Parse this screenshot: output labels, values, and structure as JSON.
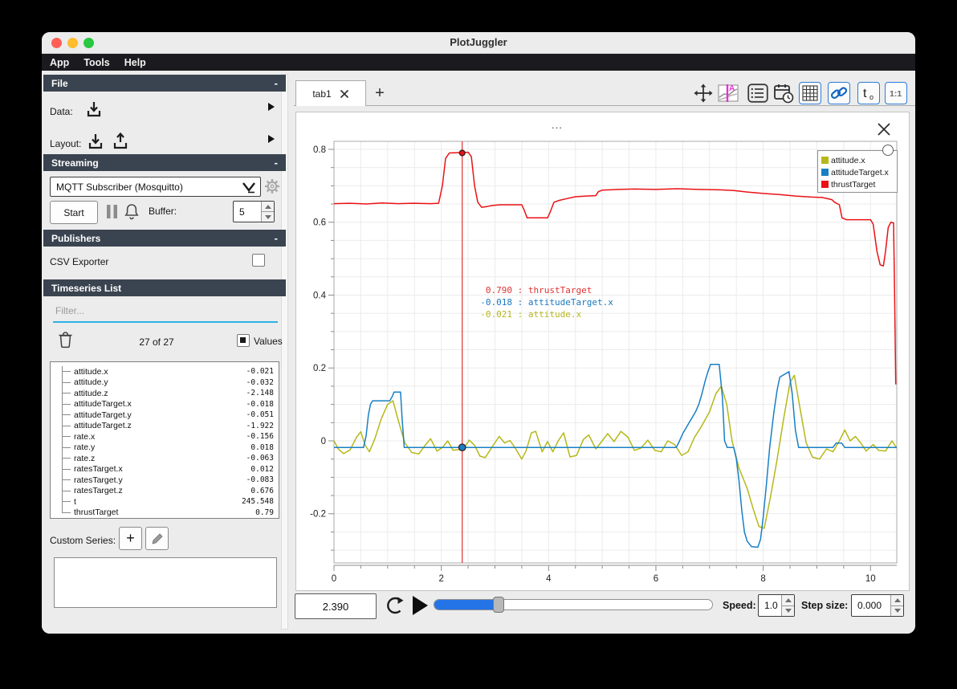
{
  "window": {
    "title": "PlotJuggler"
  },
  "menu": {
    "items": [
      "App",
      "Tools",
      "Help"
    ]
  },
  "icons": {
    "collapse": "-",
    "tracker_letter": "A",
    "t0_main": "t",
    "t0_sub": "o",
    "ratio": "1:1",
    "tab_add": "+",
    "custom_add": "+",
    "separator": " : "
  },
  "sidebar": {
    "file_section": {
      "title": "File",
      "data_label": "Data:",
      "layout_label": "Layout:"
    },
    "streaming_section": {
      "title": "Streaming",
      "source_selected": "MQTT Subscriber (Mosquitto)",
      "start_label": "Start",
      "buffer_label": "Buffer:",
      "buffer_value": "5"
    },
    "publishers_section": {
      "title": "Publishers",
      "csv_exporter_label": "CSV Exporter"
    },
    "timeseries_section": {
      "title": "Timeseries List",
      "filter_placeholder": "Filter...",
      "count_label": "27 of 27",
      "values_label": "Values",
      "items": [
        {
          "name": "attitude.x",
          "value": "-0.021"
        },
        {
          "name": "attitude.y",
          "value": "-0.032"
        },
        {
          "name": "attitude.z",
          "value": "-2.148"
        },
        {
          "name": "attitudeTarget.x",
          "value": "-0.018"
        },
        {
          "name": "attitudeTarget.y",
          "value": "-0.051"
        },
        {
          "name": "attitudeTarget.z",
          "value": "-1.922"
        },
        {
          "name": "rate.x",
          "value": "-0.156"
        },
        {
          "name": "rate.y",
          "value": "0.018"
        },
        {
          "name": "rate.z",
          "value": "-0.063"
        },
        {
          "name": "ratesTarget.x",
          "value": "0.012"
        },
        {
          "name": "ratesTarget.y",
          "value": "-0.083"
        },
        {
          "name": "ratesTarget.z",
          "value": "0.676"
        },
        {
          "name": "t",
          "value": "245.548"
        },
        {
          "name": "thrustTarget",
          "value": "0.79"
        }
      ],
      "custom_series_label": "Custom Series:"
    }
  },
  "main": {
    "tabs": [
      {
        "label": "tab1"
      }
    ],
    "plot": {
      "title": "...",
      "tooltip": [
        {
          "value": "0.790",
          "name": "thrustTarget",
          "color": "#e23333"
        },
        {
          "value": "-0.018",
          "name": "attitudeTarget.x",
          "color": "#1779be"
        },
        {
          "value": "-0.021",
          "name": "attitude.x",
          "color": "#b5b818"
        }
      ]
    },
    "footer": {
      "time_value": "2.390",
      "speed_label": "Speed:",
      "speed_value": "1.0",
      "step_label": "Step size:",
      "step_value": "0.000"
    }
  },
  "chart_data": {
    "type": "line",
    "title": "...",
    "xlabel": "",
    "ylabel": "",
    "x_range": [
      0,
      10.49
    ],
    "y_range": [
      -0.335,
      0.822
    ],
    "x_ticks": [
      0,
      2,
      4,
      6,
      8,
      10
    ],
    "y_ticks": [
      -0.2,
      0,
      0.2,
      0.4,
      0.6,
      0.8
    ],
    "x_minor_step": 0.5,
    "y_minor_step": 0.05,
    "grid": true,
    "legend_position": "top-right",
    "tracker": {
      "x": 2.39,
      "points": [
        {
          "series": "thrustTarget",
          "y": 0.79
        },
        {
          "series": "attitudeTarget.x",
          "y": -0.018
        }
      ]
    },
    "series": [
      {
        "name": "attitude.x",
        "color": "#b5b818",
        "x": [
          0,
          0.08,
          0.18,
          0.3,
          0.42,
          0.5,
          0.58,
          0.66,
          0.76,
          0.88,
          1.0,
          1.1,
          1.2,
          1.32,
          1.45,
          1.58,
          1.7,
          1.8,
          1.92,
          2.02,
          2.12,
          2.22,
          2.32,
          2.42,
          2.52,
          2.62,
          2.72,
          2.82,
          2.95,
          3.08,
          3.18,
          3.28,
          3.38,
          3.5,
          3.58,
          3.68,
          3.76,
          3.88,
          3.98,
          4.08,
          4.18,
          4.28,
          4.4,
          4.52,
          4.65,
          4.75,
          4.88,
          5.0,
          5.1,
          5.22,
          5.35,
          5.48,
          5.6,
          5.72,
          5.85,
          5.98,
          6.1,
          6.22,
          6.35,
          6.48,
          6.6,
          6.72,
          6.85,
          7.0,
          7.12,
          7.22,
          7.32,
          7.42,
          7.55,
          7.7,
          7.82,
          7.92,
          8.02,
          8.14,
          8.26,
          8.38,
          8.5,
          8.58,
          8.68,
          8.8,
          8.92,
          9.05,
          9.18,
          9.3,
          9.42,
          9.52,
          9.62,
          9.72,
          9.82,
          9.92,
          10.05,
          10.15,
          10.28,
          10.4,
          10.49
        ],
        "y": [
          0.0,
          -0.022,
          -0.035,
          -0.025,
          0.01,
          0.025,
          -0.012,
          -0.03,
          0.005,
          0.06,
          0.1,
          0.11,
          0.055,
          -0.005,
          -0.032,
          -0.036,
          -0.012,
          0.006,
          -0.028,
          -0.018,
          0.0,
          -0.026,
          -0.024,
          -0.021,
          0.002,
          -0.012,
          -0.042,
          -0.046,
          -0.016,
          0.012,
          -0.006,
          0.001,
          -0.02,
          -0.05,
          -0.028,
          0.022,
          0.026,
          -0.03,
          -0.002,
          -0.03,
          0.0,
          0.022,
          -0.044,
          -0.04,
          0.004,
          0.016,
          -0.022,
          0.0,
          0.02,
          -0.002,
          0.026,
          0.01,
          -0.026,
          -0.02,
          0.002,
          -0.026,
          -0.03,
          0.0,
          -0.01,
          -0.04,
          -0.03,
          0.01,
          0.04,
          0.08,
          0.13,
          0.15,
          0.1,
          0.0,
          -0.075,
          -0.13,
          -0.19,
          -0.235,
          -0.24,
          -0.15,
          -0.05,
          0.06,
          0.16,
          0.18,
          0.095,
          -0.005,
          -0.045,
          -0.05,
          -0.022,
          -0.03,
          0.0,
          0.03,
          0.0,
          0.012,
          -0.006,
          -0.028,
          -0.01,
          -0.026,
          -0.028,
          0.0,
          -0.02
        ]
      },
      {
        "name": "attitudeTarget.x",
        "color": "#187fc4",
        "x": [
          0,
          0.55,
          0.6,
          0.64,
          0.68,
          0.72,
          1.04,
          1.08,
          1.12,
          1.24,
          1.27,
          1.31,
          2.0,
          3.0,
          4.0,
          5.0,
          6.0,
          6.38,
          6.44,
          6.5,
          6.56,
          6.62,
          6.68,
          6.74,
          6.8,
          6.86,
          6.92,
          6.97,
          7.02,
          7.18,
          7.24,
          7.28,
          7.33,
          7.45,
          7.5,
          7.55,
          7.6,
          7.65,
          7.7,
          7.78,
          7.9,
          7.95,
          8.0,
          8.06,
          8.12,
          8.2,
          8.26,
          8.31,
          8.48,
          8.54,
          8.6,
          8.66,
          9.3,
          9.36,
          9.46,
          9.52,
          10.0,
          10.49
        ],
        "y": [
          -0.018,
          -0.018,
          0.015,
          0.07,
          0.1,
          0.11,
          0.11,
          0.12,
          0.134,
          0.134,
          0.06,
          -0.018,
          -0.018,
          -0.018,
          -0.018,
          -0.018,
          -0.018,
          -0.018,
          0.0,
          0.02,
          0.035,
          0.05,
          0.065,
          0.08,
          0.1,
          0.13,
          0.165,
          0.19,
          0.21,
          0.21,
          0.12,
          0.0,
          -0.018,
          -0.018,
          -0.05,
          -0.11,
          -0.19,
          -0.25,
          -0.275,
          -0.29,
          -0.292,
          -0.27,
          -0.21,
          -0.12,
          -0.02,
          0.08,
          0.14,
          0.175,
          0.19,
          0.13,
          0.03,
          -0.018,
          -0.018,
          -0.006,
          -0.006,
          -0.018,
          -0.018,
          -0.018
        ]
      },
      {
        "name": "thrustTarget",
        "color": "#ea1216",
        "x": [
          0,
          0.3,
          0.6,
          0.9,
          1.2,
          1.5,
          1.8,
          1.95,
          2.02,
          2.08,
          2.15,
          2.5,
          2.56,
          2.62,
          2.68,
          2.75,
          2.85,
          2.95,
          3.1,
          3.5,
          3.54,
          3.6,
          3.98,
          4.03,
          4.1,
          4.2,
          4.35,
          4.5,
          4.7,
          4.88,
          4.93,
          5.0,
          5.3,
          5.6,
          6.0,
          6.4,
          6.8,
          7.2,
          7.45,
          7.7,
          8.0,
          8.3,
          8.6,
          8.9,
          9.1,
          9.28,
          9.33,
          9.42,
          9.47,
          9.55,
          9.8,
          10.0,
          10.05,
          10.12,
          10.18,
          10.24,
          10.28,
          10.33,
          10.38,
          10.43,
          10.45,
          10.47
        ],
        "y": [
          0.651,
          0.652,
          0.65,
          0.653,
          0.651,
          0.652,
          0.651,
          0.652,
          0.7,
          0.775,
          0.79,
          0.792,
          0.78,
          0.7,
          0.655,
          0.641,
          0.643,
          0.646,
          0.648,
          0.648,
          0.635,
          0.612,
          0.612,
          0.628,
          0.655,
          0.66,
          0.665,
          0.67,
          0.672,
          0.673,
          0.684,
          0.688,
          0.69,
          0.691,
          0.69,
          0.692,
          0.69,
          0.689,
          0.687,
          0.683,
          0.679,
          0.676,
          0.672,
          0.669,
          0.668,
          0.662,
          0.655,
          0.648,
          0.612,
          0.607,
          0.607,
          0.607,
          0.595,
          0.52,
          0.483,
          0.48,
          0.52,
          0.585,
          0.6,
          0.598,
          0.4,
          0.155
        ]
      }
    ]
  }
}
